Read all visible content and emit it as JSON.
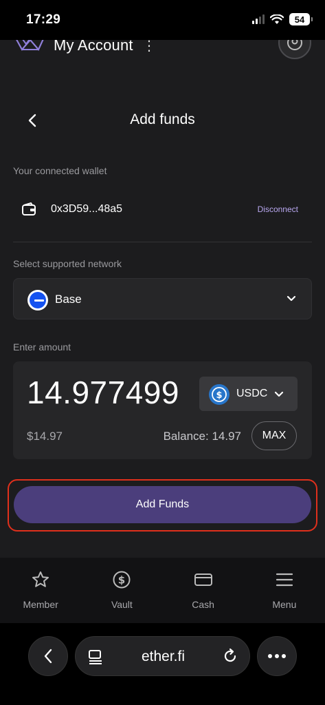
{
  "status_bar": {
    "time": "17:29",
    "battery": "54",
    "icons": [
      "signal-icon",
      "wifi-icon",
      "battery-icon"
    ]
  },
  "header": {
    "title": "My Account",
    "more_icon": "⋮",
    "logo": "etherfi-logo",
    "profile_icon": "user-icon"
  },
  "page": {
    "title": "Add funds",
    "back_icon": "chevron-left-icon"
  },
  "wallet": {
    "label": "Your connected wallet",
    "address": "0x3D59...48a5",
    "disconnect_label": "Disconnect",
    "icon": "wallet-icon"
  },
  "network": {
    "label": "Select supported network",
    "selected": "Base",
    "icon": "base-network-icon"
  },
  "amount": {
    "label": "Enter amount",
    "value": "14.977499",
    "token": "USDC",
    "usd_value": "$14.97",
    "balance": "Balance: 14.97",
    "max_label": "MAX"
  },
  "action": {
    "add_funds_label": "Add Funds"
  },
  "bottom_nav": {
    "items": [
      {
        "label": "Member",
        "icon": "star-icon"
      },
      {
        "label": "Vault",
        "icon": "dollar-circle-icon"
      },
      {
        "label": "Cash",
        "icon": "card-icon"
      },
      {
        "label": "Menu",
        "icon": "hamburger-icon"
      }
    ]
  },
  "browser": {
    "url": "ether.fi"
  },
  "colors": {
    "accent_button": "#4b3e7c",
    "highlight_border": "#e0301c",
    "disconnect_text": "#b9a8f0",
    "usdc_blue": "#2775ca",
    "base_blue": "#1552f0"
  }
}
